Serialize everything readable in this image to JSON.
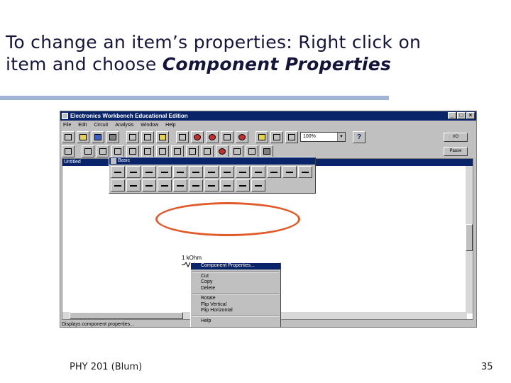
{
  "slide": {
    "title_line1": "To change an item’s properties: Right click on",
    "title_line2_plain": "item and choose ",
    "title_line2_bold": "Component Properties",
    "footer_left": "PHY 201 (Blum)",
    "page_number": "35"
  },
  "app": {
    "title": "Electronics Workbench Educational Edition",
    "window_buttons": [
      "_",
      "□",
      "×"
    ],
    "menu": [
      "File",
      "Edit",
      "Circuit",
      "Analysis",
      "Window",
      "Help"
    ],
    "zoom_value": "100%",
    "zoom_arrow": "▼",
    "help_glyph": "?",
    "side_buttons": [
      "I/O",
      "Pause"
    ],
    "doc_title": "Untitled",
    "status_text": "Displays component properties..."
  },
  "palette": {
    "title": "Basic"
  },
  "circuit": {
    "resistor_label": "1 kOhm"
  },
  "context_menu": {
    "items": [
      "Component Properties...",
      "Cut",
      "Copy",
      "Delete",
      "Rotate",
      "Flip Vertical",
      "Flip Horizontal",
      "Help"
    ]
  },
  "colors": {
    "title_rule": "#9fb4d6",
    "highlight": "#e05a2a",
    "titlebar": "#0a246a",
    "window_face": "#c0c0c0"
  }
}
